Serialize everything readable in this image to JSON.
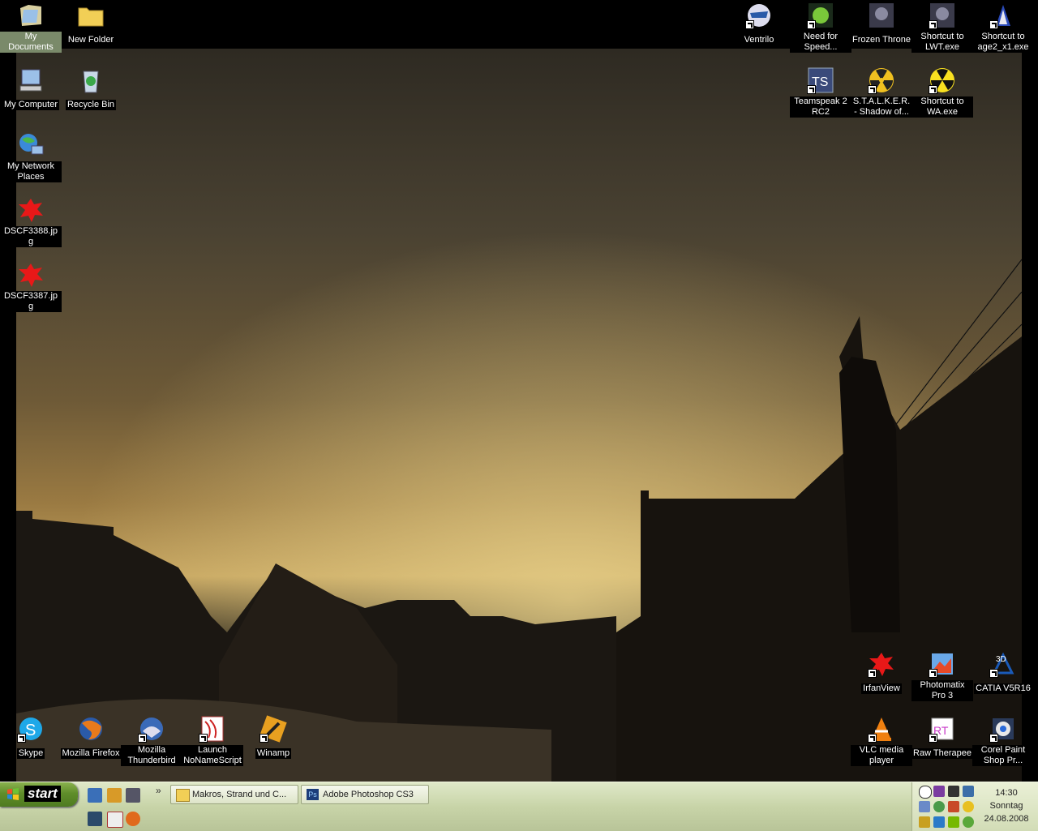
{
  "desktop": {
    "icons": [
      {
        "label": "My Documents",
        "type": "mydocs",
        "selected": true
      },
      {
        "label": "New Folder",
        "type": "folder"
      },
      {
        "label": "My Computer",
        "type": "computer"
      },
      {
        "label": "Recycle Bin",
        "type": "recycle"
      },
      {
        "label": "My Network Places",
        "type": "network"
      },
      {
        "label": "DSCF3388.jpg",
        "type": "irfan-image"
      },
      {
        "label": "DSCF3387.jpg",
        "type": "irfan-image"
      },
      {
        "label": "Ventrilo",
        "type": "ventrilo",
        "shortcut": true
      },
      {
        "label": "Need for Speed...",
        "type": "nfs",
        "shortcut": true
      },
      {
        "label": "Frozen Throne",
        "type": "wc3"
      },
      {
        "label": "Shortcut to LWT.exe",
        "type": "wc3",
        "shortcut": true
      },
      {
        "label": "Shortcut to age2_x1.exe",
        "type": "aoe",
        "shortcut": true
      },
      {
        "label": "Teamspeak 2 RC2",
        "type": "teamspeak",
        "shortcut": true
      },
      {
        "label": "S.T.A.L.K.E.R. - Shadow of...",
        "type": "radiation",
        "shortcut": true
      },
      {
        "label": "Shortcut to WA.exe",
        "type": "radiation-yellow",
        "shortcut": true
      },
      {
        "label": "IrfanView",
        "type": "irfan",
        "shortcut": true
      },
      {
        "label": "Photomatix Pro 3",
        "type": "photomatix",
        "shortcut": true
      },
      {
        "label": "CATIA V5R16",
        "type": "catia",
        "shortcut": true
      },
      {
        "label": "VLC media player",
        "type": "vlc",
        "shortcut": true
      },
      {
        "label": "Raw Therapee",
        "type": "rawtherapee",
        "shortcut": true
      },
      {
        "label": "Corel Paint Shop Pr...",
        "type": "corel",
        "shortcut": true
      },
      {
        "label": "Skype",
        "type": "skype",
        "shortcut": true
      },
      {
        "label": "Mozilla Firefox",
        "type": "firefox"
      },
      {
        "label": "Mozilla Thunderbird",
        "type": "thunderbird",
        "shortcut": true
      },
      {
        "label": "Launch NoNameScript",
        "type": "script",
        "shortcut": true
      },
      {
        "label": "Winamp",
        "type": "winamp",
        "shortcut": true
      }
    ]
  },
  "taskbar": {
    "start_label": "start",
    "overflow_chevron": "»",
    "tasks": [
      {
        "label": "Makros, Strand und C...",
        "icon": "folder-icon"
      },
      {
        "label": "Adobe Photoshop CS3",
        "icon": "photoshop-icon"
      }
    ],
    "clock": {
      "time": "14:30",
      "day": "Sonntag",
      "date": "24.08.2008"
    }
  },
  "colors": {
    "taskbar": "#c8d4a8",
    "start": "#5f8d2a",
    "label_bg": "#000000",
    "selected_label_bg": "#7a8a6a"
  }
}
